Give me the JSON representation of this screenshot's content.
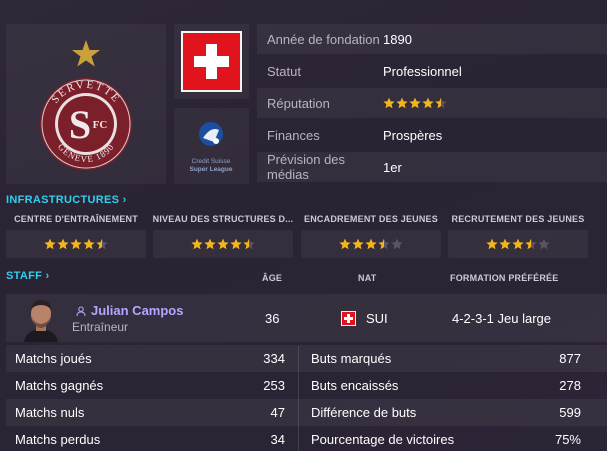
{
  "club": {
    "crest": {
      "text_top": "SERVETTE",
      "text_bottom": "GENEVE 1890",
      "monogram": "S",
      "monogram_small": "FC",
      "colors": {
        "maroon": "#7b1f2b",
        "star": "#c9a13a"
      }
    },
    "league_logo_text": [
      "Credit Suisse",
      "Super League"
    ]
  },
  "info": [
    {
      "label": "Année de fondation",
      "value": "1890"
    },
    {
      "label": "Statut",
      "value": "Professionnel"
    },
    {
      "label": "Réputation",
      "value": "",
      "stars": 4.5
    },
    {
      "label": "Finances",
      "value": "Prospères"
    },
    {
      "label": "Prévision des médias",
      "value": "1er"
    }
  ],
  "infrastructures": {
    "title": "INFRASTRUCTURES",
    "items": [
      {
        "label": "CENTRE D'ENTRAÎNEMENT",
        "stars": 4.5
      },
      {
        "label": "NIVEAU DES STRUCTURES D...",
        "stars": 4.5
      },
      {
        "label": "ENCADREMENT DES JEUNES",
        "stars": 3.5
      },
      {
        "label": "RECRUTEMENT DES JEUNES",
        "stars": 3.5
      }
    ]
  },
  "staff": {
    "title": "STAFF",
    "headers": {
      "age": "ÂGE",
      "nat": "NAT",
      "formation": "FORMATION PRÉFÉRÉE"
    },
    "member": {
      "name": "Julian Campos",
      "role": "Entraîneur",
      "age": "36",
      "nat": "SUI",
      "formation": "4-2-3-1 Jeu large"
    }
  },
  "stats": {
    "left": [
      {
        "label": "Matchs joués",
        "value": "334"
      },
      {
        "label": "Matchs gagnés",
        "value": "253"
      },
      {
        "label": "Matchs nuls",
        "value": "47"
      },
      {
        "label": "Matchs perdus",
        "value": "34"
      }
    ],
    "right": [
      {
        "label": "Buts marqués",
        "value": "877"
      },
      {
        "label": "Buts encaissés",
        "value": "278"
      },
      {
        "label": "Différence de buts",
        "value": "599"
      },
      {
        "label": "Pourcentage de victoires",
        "value": "75%"
      }
    ]
  },
  "colors": {
    "accent": "#2fd0ee",
    "star_filled": "#f2b51e",
    "star_empty": "#5a5463",
    "swiss_red": "#e1141e",
    "link_name": "#b7a6ff"
  }
}
